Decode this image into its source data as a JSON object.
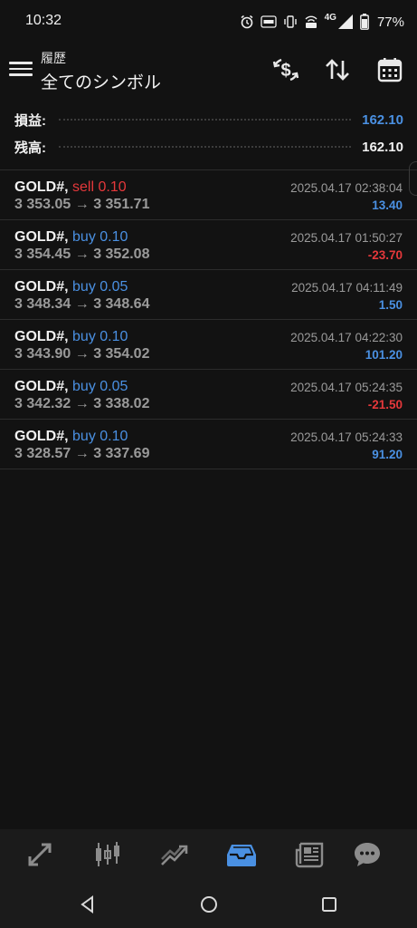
{
  "status_bar": {
    "time": "10:32",
    "icons": [
      "alarm-icon",
      "auto-icon",
      "vibrate-icon",
      "volte-icon",
      "signal-4g-icon",
      "battery-icon"
    ],
    "network_label": "4G",
    "battery_percent": "77%"
  },
  "appbar": {
    "subtitle": "履歴",
    "title": "全てのシンボル",
    "icons": [
      "currency-exchange-icon",
      "sort-icon",
      "calendar-icon"
    ]
  },
  "summary": {
    "profit_label": "損益:",
    "profit_value": "162.10",
    "balance_label": "残高:",
    "balance_value": "162.10"
  },
  "trades": [
    {
      "symbol": "GOLD#,",
      "side": "sell",
      "volume": "0.10",
      "open_price": "3 353.05",
      "close_price": "3 351.71",
      "time": "2025.04.17 02:38:04",
      "profit": "13.40",
      "positive": true
    },
    {
      "symbol": "GOLD#,",
      "side": "buy",
      "volume": "0.10",
      "open_price": "3 354.45",
      "close_price": "3 352.08",
      "time": "2025.04.17 01:50:27",
      "profit": "-23.70",
      "positive": false
    },
    {
      "symbol": "GOLD#,",
      "side": "buy",
      "volume": "0.05",
      "open_price": "3 348.34",
      "close_price": "3 348.64",
      "time": "2025.04.17 04:11:49",
      "profit": "1.50",
      "positive": true
    },
    {
      "symbol": "GOLD#,",
      "side": "buy",
      "volume": "0.10",
      "open_price": "3 343.90",
      "close_price": "3 354.02",
      "time": "2025.04.17 04:22:30",
      "profit": "101.20",
      "positive": true
    },
    {
      "symbol": "GOLD#,",
      "side": "buy",
      "volume": "0.05",
      "open_price": "3 342.32",
      "close_price": "3 338.02",
      "time": "2025.04.17 05:24:35",
      "profit": "-21.50",
      "positive": false
    },
    {
      "symbol": "GOLD#,",
      "side": "buy",
      "volume": "0.10",
      "open_price": "3 328.57",
      "close_price": "3 337.69",
      "time": "2025.04.17 05:24:33",
      "profit": "91.20",
      "positive": true
    }
  ],
  "arrow": "→",
  "bottom_tabs": [
    {
      "icon": "quotes-icon",
      "active": false
    },
    {
      "icon": "chart-icon",
      "active": false
    },
    {
      "icon": "trade-icon",
      "active": false
    },
    {
      "icon": "history-icon",
      "active": true
    },
    {
      "icon": "news-icon",
      "active": false
    },
    {
      "icon": "messages-icon",
      "active": false
    }
  ],
  "colors": {
    "background": "#121212",
    "accent_blue": "#4a90e2",
    "loss_red": "#e5383b",
    "muted_text": "#9a9a9a"
  }
}
